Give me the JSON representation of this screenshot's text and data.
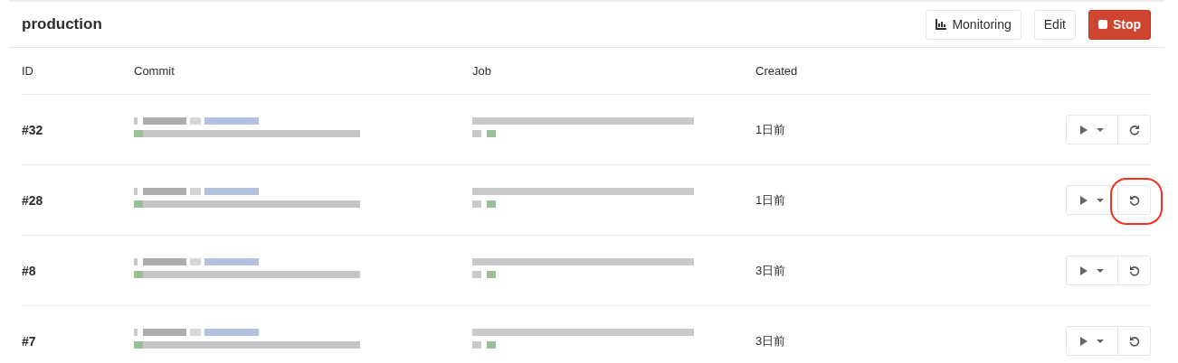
{
  "environment": {
    "name": "production"
  },
  "actions": [
    {
      "label": "Monitoring",
      "kind": "monitoring"
    },
    {
      "label": "Edit",
      "kind": "edit"
    },
    {
      "label": "Stop",
      "kind": "stop"
    }
  ],
  "table": {
    "columns": [
      "ID",
      "Commit",
      "Job",
      "Created"
    ],
    "rows": [
      {
        "id": "#32",
        "created": "1日前",
        "kind": "redeploy",
        "highlighted": false
      },
      {
        "id": "#28",
        "created": "1日前",
        "kind": "rollback",
        "highlighted": true
      },
      {
        "id": "#8",
        "created": "3日前",
        "kind": "rollback",
        "highlighted": false
      },
      {
        "id": "#7",
        "created": "3日前",
        "kind": "rollback",
        "highlighted": false
      }
    ]
  }
}
